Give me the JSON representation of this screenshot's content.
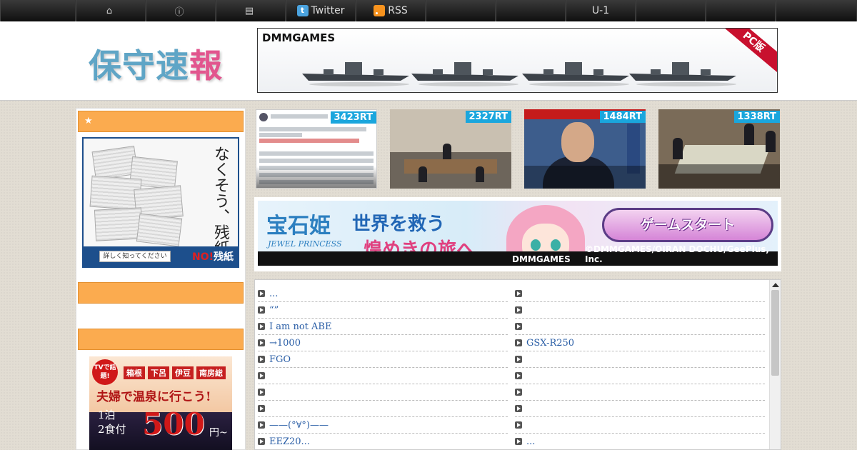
{
  "nav": {
    "items": [
      {
        "icon": "home-icon",
        "label": ""
      },
      {
        "icon": "info-icon",
        "label": ""
      },
      {
        "icon": "list-icon",
        "label": ""
      },
      {
        "icon": "twitter-icon",
        "label": "Twitter"
      },
      {
        "icon": "rss-icon",
        "label": "RSS"
      },
      {
        "icon": "",
        "label": ""
      },
      {
        "icon": "",
        "label": "U-1"
      },
      {
        "icon": "",
        "label": ""
      },
      {
        "icon": "",
        "label": ""
      }
    ]
  },
  "header": {
    "logo_part1": "保守速",
    "logo_part2": "報",
    "top_banner": {
      "brand": "DMMGAMES",
      "badge": "PC版"
    }
  },
  "sidebar": {
    "heading1": "★",
    "heading2": "",
    "heading3": "",
    "zanshi_ad": {
      "vertical_text": "なくそう、残紙",
      "button": "詳しく知ってください",
      "no_text": "NO!",
      "no_suffix": "残紙"
    },
    "onsen_ad": {
      "tv_badge": "TVで話題!",
      "tags": [
        "箱根",
        "下呂",
        "伊豆",
        "南房総"
      ],
      "title": "夫婦で温泉に行こう!",
      "line1": "1泊",
      "line2": "2食付",
      "price": "500",
      "suffix": "円~"
    }
  },
  "thumbs": [
    {
      "rt": "3423RT"
    },
    {
      "rt": "2327RT"
    },
    {
      "rt": "1484RT"
    },
    {
      "rt": "1338RT"
    }
  ],
  "jewel_banner": {
    "logo": "宝石姫",
    "logo_sub": "JEWEL PRINCESS",
    "catch1": "世界を救う",
    "catch2": "煌めきの旅へ",
    "start": "ゲームスタート",
    "brand": "DMMGAMES",
    "copyright": "©DMMGAMES/OIRAN DOCHU/GeePlus, Inc."
  },
  "links": {
    "left": [
      "...",
      "“”",
      "I am not ABE",
      "→1000",
      "FGO",
      "",
      "",
      "",
      "——(°∀°)——",
      "EEZ20..."
    ],
    "right": [
      "",
      "",
      "",
      "GSX-R250",
      "",
      "",
      "",
      "",
      "",
      "..."
    ]
  },
  "colors": {
    "accent_orange": "#fbab4f",
    "rt_blue": "#1aa6dd",
    "link_blue": "#2a5ea6"
  }
}
